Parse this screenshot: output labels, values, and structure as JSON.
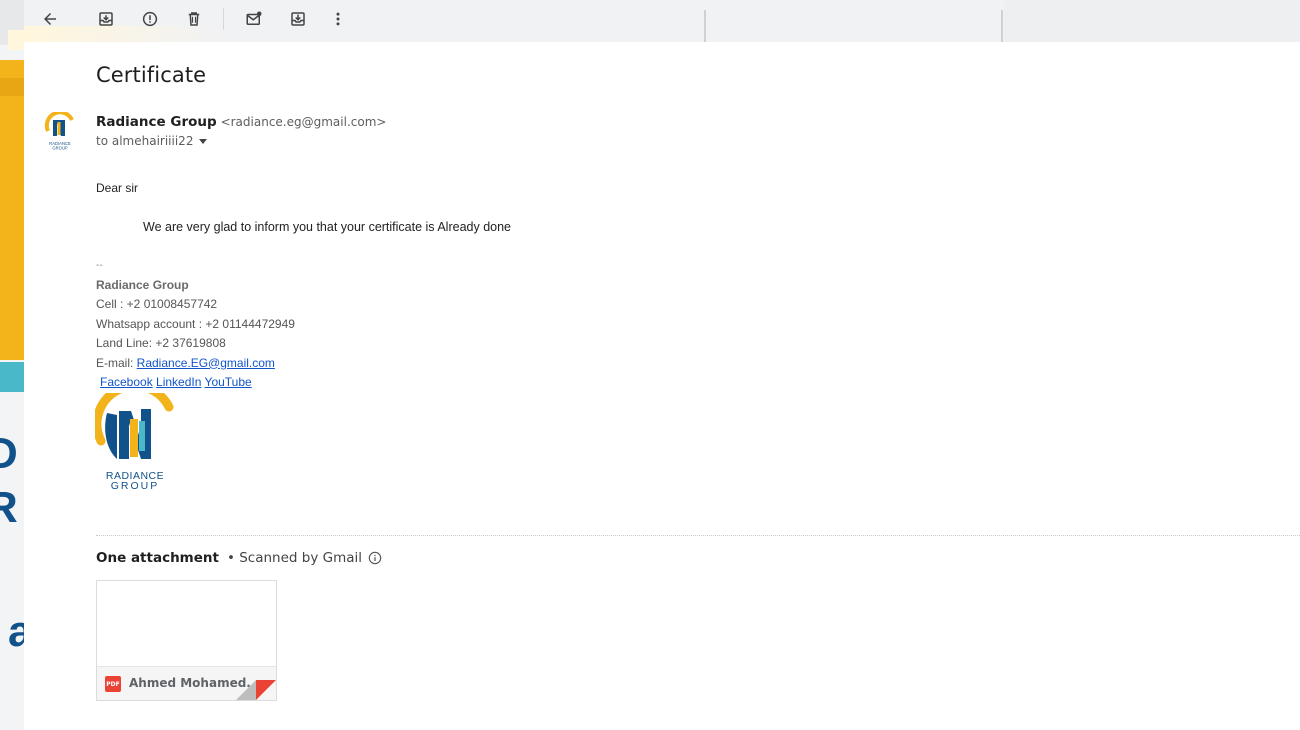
{
  "toolbar": {
    "buttons": [
      {
        "name": "back",
        "icon": "arrow-left-icon"
      },
      {
        "name": "archive",
        "icon": "archive-icon"
      },
      {
        "name": "report-spam",
        "icon": "alert-circle-icon"
      },
      {
        "name": "delete",
        "icon": "trash-icon"
      },
      {
        "name": "mark-unread",
        "icon": "mail-unread-icon"
      },
      {
        "name": "move-to",
        "icon": "move-to-inbox-icon"
      },
      {
        "name": "more",
        "icon": "more-vertical-icon"
      }
    ]
  },
  "email": {
    "subject": "Certificate",
    "sender_name": "Radiance Group",
    "sender_email": "<radiance.eg@gmail.com>",
    "recipient": "to almehairiiii22",
    "greeting": "Dear sir",
    "message": "We are very glad to inform you that your certificate is Already done",
    "sig_separator": "--",
    "sig_company": "Radiance Group",
    "sig_cell": "Cell : +2 01008457742",
    "sig_whatsapp": "Whatsapp account : +2 01144472949",
    "sig_landline": "Land Line: +2 37619808",
    "sig_email_label": "E-mail: ",
    "sig_email_link": "Radiance.EG@gmail.com",
    "links": {
      "facebook": "Facebook",
      "linkedin": "LinkedIn",
      "youtube": "YouTube "
    },
    "logo_text": "RADIANCE GROUP"
  },
  "attachments": {
    "count_label": "One attachment",
    "scan_label": "• Scanned by Gmail",
    "items": [
      {
        "name": "Ahmed Mohamed...",
        "type": "PDF"
      }
    ]
  },
  "wallpaper": {
    "letters": [
      "D",
      "R",
      "a"
    ]
  },
  "colors": {
    "brand_blue": "#12528a",
    "brand_yellow": "#f2b31b",
    "link": "#1155cc",
    "pdf_red": "#ea4335"
  }
}
